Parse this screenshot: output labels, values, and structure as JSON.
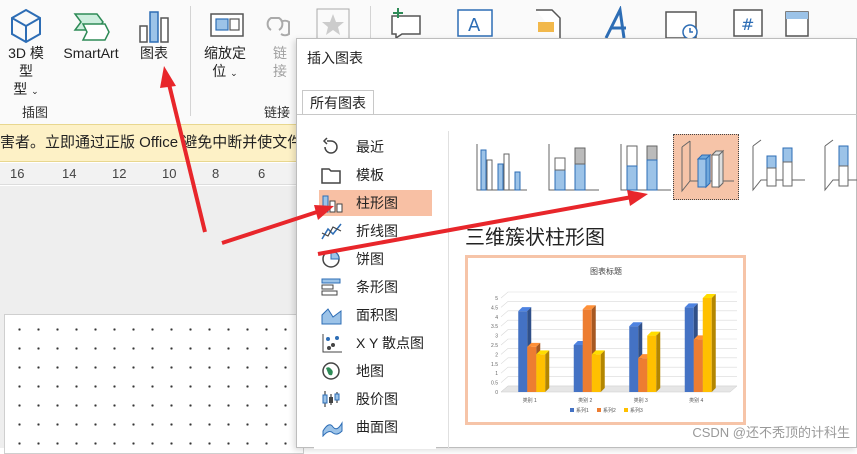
{
  "ribbon": {
    "btn_3d": "3D 模型",
    "btn_3d_2": "型",
    "btn_smartart": "SmartArt",
    "btn_chart": "图表",
    "btn_zoom": "缩放定",
    "btn_zoom_2": "位",
    "btn_link": "链",
    "btn_link_2": "接",
    "group_illustrations": "插图",
    "group_links": "链接"
  },
  "infobar": {
    "text": "害者。立即通过正版 Office 避免中断并使文件"
  },
  "ruler": {
    "ticks": [
      "16",
      "14",
      "12",
      "10",
      "8",
      "6"
    ]
  },
  "dialog": {
    "title": "插入图表",
    "tab_all": "所有图表",
    "categories": [
      "最近",
      "模板",
      "柱形图",
      "折线图",
      "饼图",
      "条形图",
      "面积图",
      "X Y 散点图",
      "地图",
      "股价图",
      "曲面图"
    ],
    "selected_category": "柱形图",
    "chart_type_name": "三维簇状柱形图"
  },
  "colors": {
    "accent": "#f6c4a8",
    "series1": "#4472c4",
    "series2": "#ed7d31",
    "series3": "#ffc000",
    "arrow": "#e8262b"
  },
  "chart_data": {
    "type": "bar",
    "title": "图表标题",
    "categories": [
      "类别 1",
      "类别 2",
      "类别 3",
      "类别 4"
    ],
    "series": [
      {
        "name": "系列1",
        "values": [
          4.3,
          2.5,
          3.5,
          4.5
        ]
      },
      {
        "name": "系列2",
        "values": [
          2.4,
          4.4,
          1.8,
          2.8
        ]
      },
      {
        "name": "系列3",
        "values": [
          2,
          2,
          3,
          5
        ]
      }
    ],
    "ylim": [
      0,
      5
    ],
    "yticks": [
      "0",
      "0.5",
      "1",
      "1.5",
      "2",
      "2.5",
      "3",
      "3.5",
      "4",
      "4.5",
      "5"
    ],
    "legend": "bottom"
  },
  "watermark": "CSDN @还不秃顶的计科生"
}
